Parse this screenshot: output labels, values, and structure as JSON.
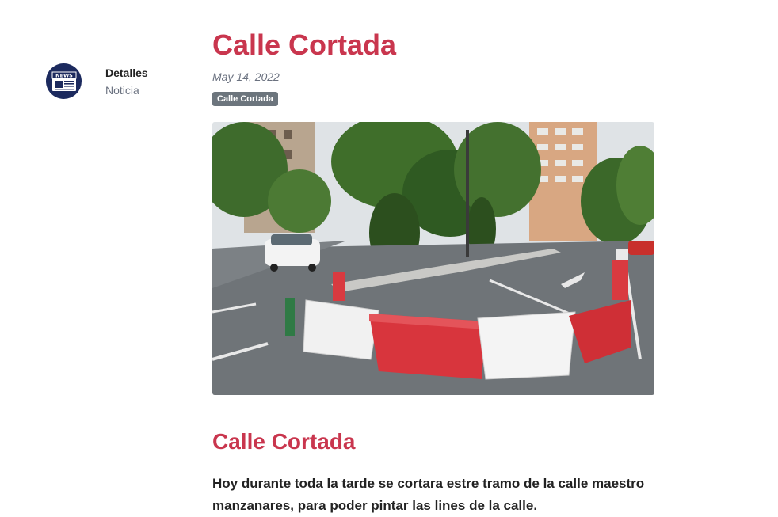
{
  "sidebar": {
    "avatar_icon": "newspaper-icon",
    "avatar_label": "NEWS",
    "title": "Detalles",
    "subtitle": "Noticia"
  },
  "article": {
    "title": "Calle Cortada",
    "date": "May 14, 2022",
    "tag": "Calle Cortada",
    "section_heading": "Calle Cortada",
    "body": "Hoy durante toda la tarde se cortara estre tramo de la calle maestro manzanares, para poder pintar las lines de la calle."
  },
  "colors": {
    "accent": "#c9364e",
    "avatar_bg": "#1c2a5e",
    "badge_bg": "#6c757d"
  }
}
